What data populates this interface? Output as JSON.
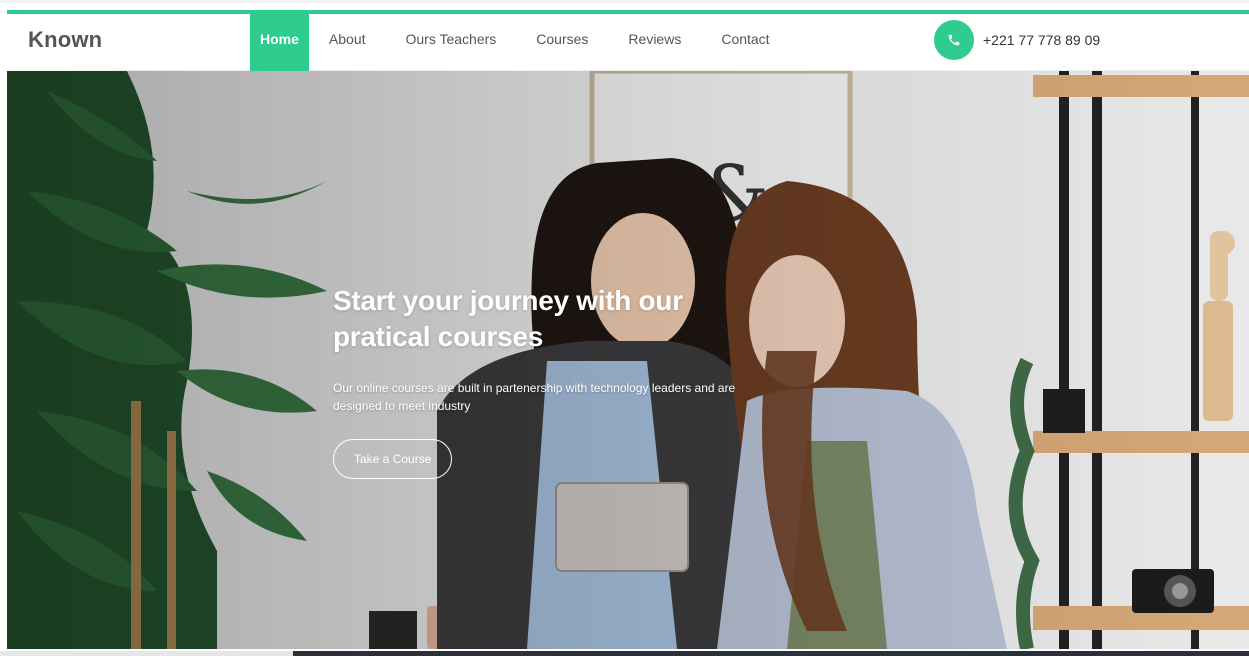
{
  "brand": "Known",
  "nav": {
    "items": [
      {
        "label": "Home"
      },
      {
        "label": "About"
      },
      {
        "label": "Ours Teachers"
      },
      {
        "label": "Courses"
      },
      {
        "label": "Reviews"
      },
      {
        "label": "Contact"
      }
    ],
    "active": "Home"
  },
  "contact": {
    "phone": "+221 77 778 89 09",
    "icon": "phone-icon"
  },
  "hero": {
    "title_line1": "Start your journey with our",
    "title_line2": "pratical courses",
    "text": "Our online courses are built in partenership with technology leaders and are designed to meet industry",
    "button_label": "Take a Course"
  },
  "colors": {
    "accent": "#2ecc8f",
    "brand_text": "#555555",
    "nav_text": "#555555"
  }
}
